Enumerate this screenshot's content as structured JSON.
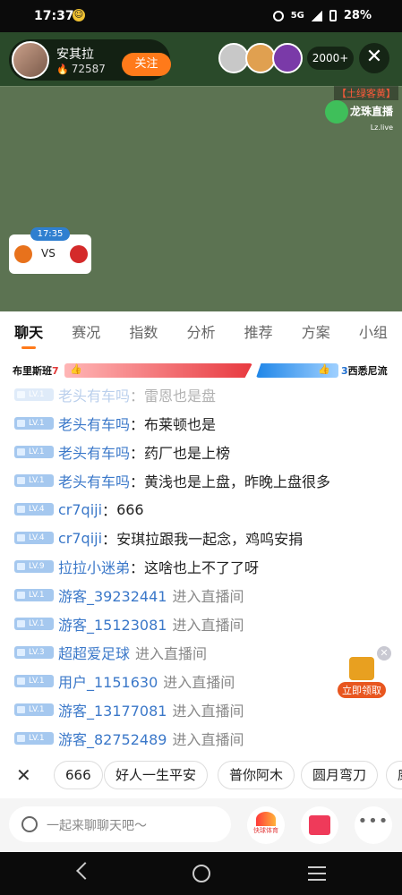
{
  "status_bar": {
    "time": "17:37",
    "network": "5G",
    "battery": "28%"
  },
  "stream": {
    "anchor_name": "安其拉",
    "heat": "72587",
    "follow_label": "关注",
    "viewer_count": "2000+",
    "corner_tag": "【土绿客黄】",
    "platform_name": "龙珠直播",
    "platform_domain": "Lz.live",
    "match_clock": "17:35",
    "vs_label": "VS"
  },
  "tabs": [
    "聊天",
    "赛况",
    "指数",
    "分析",
    "推荐",
    "方案",
    "小组"
  ],
  "vote": {
    "home_team": "布里斯班",
    "home_count": "7",
    "away_team": "西悉尼流",
    "away_count": "3"
  },
  "chat": [
    {
      "level": "LV.1",
      "user": "老头有车吗",
      "text": "雷恩也是盘",
      "type": "msg",
      "faded": true
    },
    {
      "level": "LV.1",
      "user": "老头有车吗",
      "text": "布莱顿也是",
      "type": "msg"
    },
    {
      "level": "LV.1",
      "user": "老头有车吗",
      "text": "药厂也是上榜",
      "type": "msg"
    },
    {
      "level": "LV.1",
      "user": "老头有车吗",
      "text": "黄浅也是上盘，昨晚上盘很多",
      "type": "msg"
    },
    {
      "level": "LV.4",
      "user": "cr7qiji",
      "text": "666",
      "type": "msg"
    },
    {
      "level": "LV.4",
      "user": "cr7qiji",
      "text": "安琪拉跟我一起念，鸡呜安捐",
      "type": "msg"
    },
    {
      "level": "LV.9",
      "user": "拉拉小迷弟",
      "text": "这啥也上不了了呀",
      "type": "msg"
    },
    {
      "level": "LV.1",
      "user": "游客_39232441",
      "text": "进入直播间",
      "type": "enter"
    },
    {
      "level": "LV.1",
      "user": "游客_15123081",
      "text": "进入直播间",
      "type": "enter"
    },
    {
      "level": "LV.3",
      "user": "超超爱足球",
      "text": "进入直播间",
      "type": "enter"
    },
    {
      "level": "LV.1",
      "user": "用户_1151630",
      "text": "进入直播间",
      "type": "enter"
    },
    {
      "level": "LV.1",
      "user": "游客_13177081",
      "text": "进入直播间",
      "type": "enter"
    },
    {
      "level": "LV.1",
      "user": "游客_82752489",
      "text": "进入直播间",
      "type": "enter"
    }
  ],
  "gift_float_label": "立即领取",
  "quick_phrases": [
    "666",
    "好人一生平安",
    "普你阿木",
    "圆月弯刀",
    "康"
  ],
  "input_placeholder": "一起来聊聊天吧～",
  "app_badge": "快球体育",
  "colors": {
    "accent": "#ff7a1a",
    "username": "#3b78c9",
    "home_bar": "#e8393f",
    "away_bar": "#1f86e8"
  }
}
